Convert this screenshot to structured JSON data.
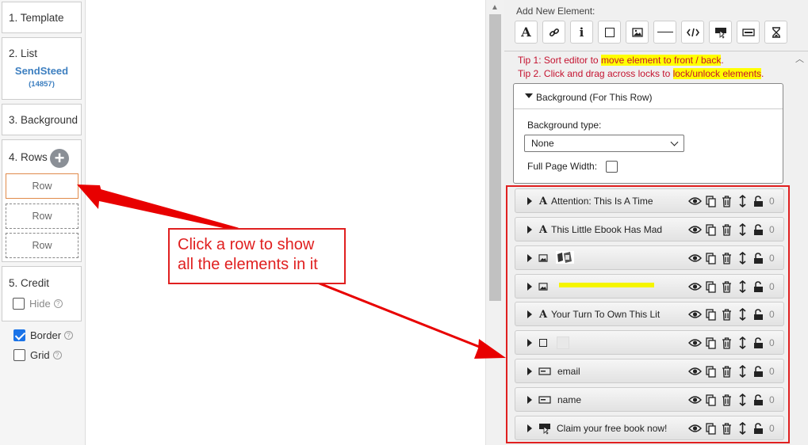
{
  "sidebar": {
    "step1": "1. Template",
    "step2": "2. List",
    "brand": "SendSteed",
    "list_count": "(14857)",
    "step3": "3. Background",
    "step4": "4. Rows",
    "rows": [
      "Row",
      "Row",
      "Row"
    ],
    "step5": "5. Credit",
    "hide_label": "Hide",
    "border_label": "Border",
    "grid_label": "Grid",
    "help_glyph": "?"
  },
  "panel": {
    "add_title": "Add New Element:",
    "tools": [
      "text-icon",
      "link-icon",
      "info-icon",
      "box-icon",
      "image-icon",
      "line-icon",
      "code-icon",
      "button-icon",
      "input-icon",
      "timer-icon"
    ],
    "tip1_prefix": "Tip 1: Sort editor to ",
    "tip1_highlight": "move element to front / back",
    "tip1_suffix": ".",
    "tip2_prefix": "Tip 2. Click and drag across locks to ",
    "tip2_highlight": "lock/unlock elements",
    "tip2_suffix": ".",
    "background": {
      "title": "Background (For This Row)",
      "type_label": "Background type:",
      "type_value": "None",
      "full_width_label": "Full Page Width:"
    },
    "elements": [
      {
        "type": "text",
        "label": "Attention: This Is A Time",
        "count": "0"
      },
      {
        "type": "text",
        "label": "This Little Ebook Has Mad",
        "count": "0"
      },
      {
        "type": "image",
        "label": "",
        "count": "0"
      },
      {
        "type": "image",
        "label": "",
        "count": "0"
      },
      {
        "type": "text",
        "label": "Your Turn To Own This Lit",
        "count": "0"
      },
      {
        "type": "box",
        "label": "",
        "count": "0"
      },
      {
        "type": "input",
        "label": "email",
        "count": "0"
      },
      {
        "type": "input",
        "label": "name",
        "count": "0"
      },
      {
        "type": "button",
        "label": "Claim your free book now!",
        "count": "0"
      }
    ]
  },
  "annotation": {
    "line1": "Click a row to show",
    "line2": "all the elements in it"
  },
  "colors": {
    "accent_red": "#e02020",
    "tip_red": "#c4122f",
    "highlight": "#ffff00",
    "brand_blue": "#3d7fc0",
    "check_blue": "#1a73e8"
  }
}
